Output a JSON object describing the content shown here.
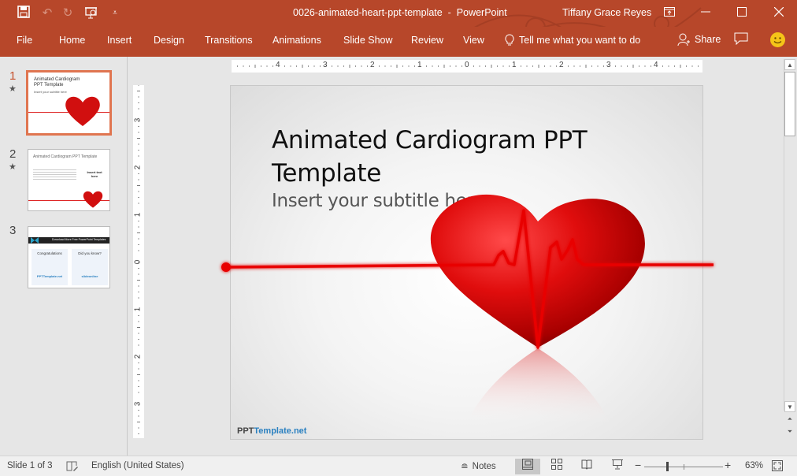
{
  "app": {
    "document_title": "0026-animated-heart-ppt-template",
    "separator": "-",
    "app_name": "PowerPoint",
    "user_name": "Tiffany Grace Reyes",
    "accent_color": "#b7472a"
  },
  "quick_access": [
    "save-icon",
    "undo-icon",
    "redo-icon",
    "start-from-beginning-icon",
    "customize-qat-icon"
  ],
  "window_controls": [
    "ribbon-display-options",
    "minimize",
    "maximize",
    "close"
  ],
  "ribbon": {
    "tabs": [
      "File",
      "Home",
      "Insert",
      "Design",
      "Transitions",
      "Animations",
      "Slide Show",
      "Review",
      "View"
    ],
    "tell_me": "Tell me what you want to do",
    "share": "Share"
  },
  "thumbnails": [
    {
      "number": "1",
      "has_animation": true,
      "selected": true,
      "title": "Animated Cardiogram PPT Template",
      "subtitle": "Insert your subtitle here"
    },
    {
      "number": "2",
      "has_animation": true,
      "selected": false,
      "title": "Animated Cardiogram PPT Template",
      "side_text": "Insert text here"
    },
    {
      "number": "3",
      "has_animation": false,
      "selected": false,
      "header": "Download More Free PowerPoint Templates",
      "box1": "Congratulations",
      "box2": "Did you know?",
      "logo1": "PPTTemplate.net",
      "logo2": "slideonline"
    }
  ],
  "ruler": {
    "horizontal": [
      "4",
      "3",
      "2",
      "1",
      "0",
      "1",
      "2",
      "3",
      "4"
    ],
    "vertical": [
      "3",
      "2",
      "1",
      "0",
      "1",
      "2",
      "3"
    ]
  },
  "slide": {
    "title": "Animated Cardiogram PPT Template",
    "subtitle": "Insert your subtitle here",
    "brand_part1": "PPT",
    "brand_part2": "Template.net"
  },
  "statusbar": {
    "slide_counter": "Slide 1 of 3",
    "language": "English (United States)",
    "notes": "Notes",
    "zoom_level": "63%",
    "zoom_percent": 63,
    "active_view": "Normal"
  }
}
